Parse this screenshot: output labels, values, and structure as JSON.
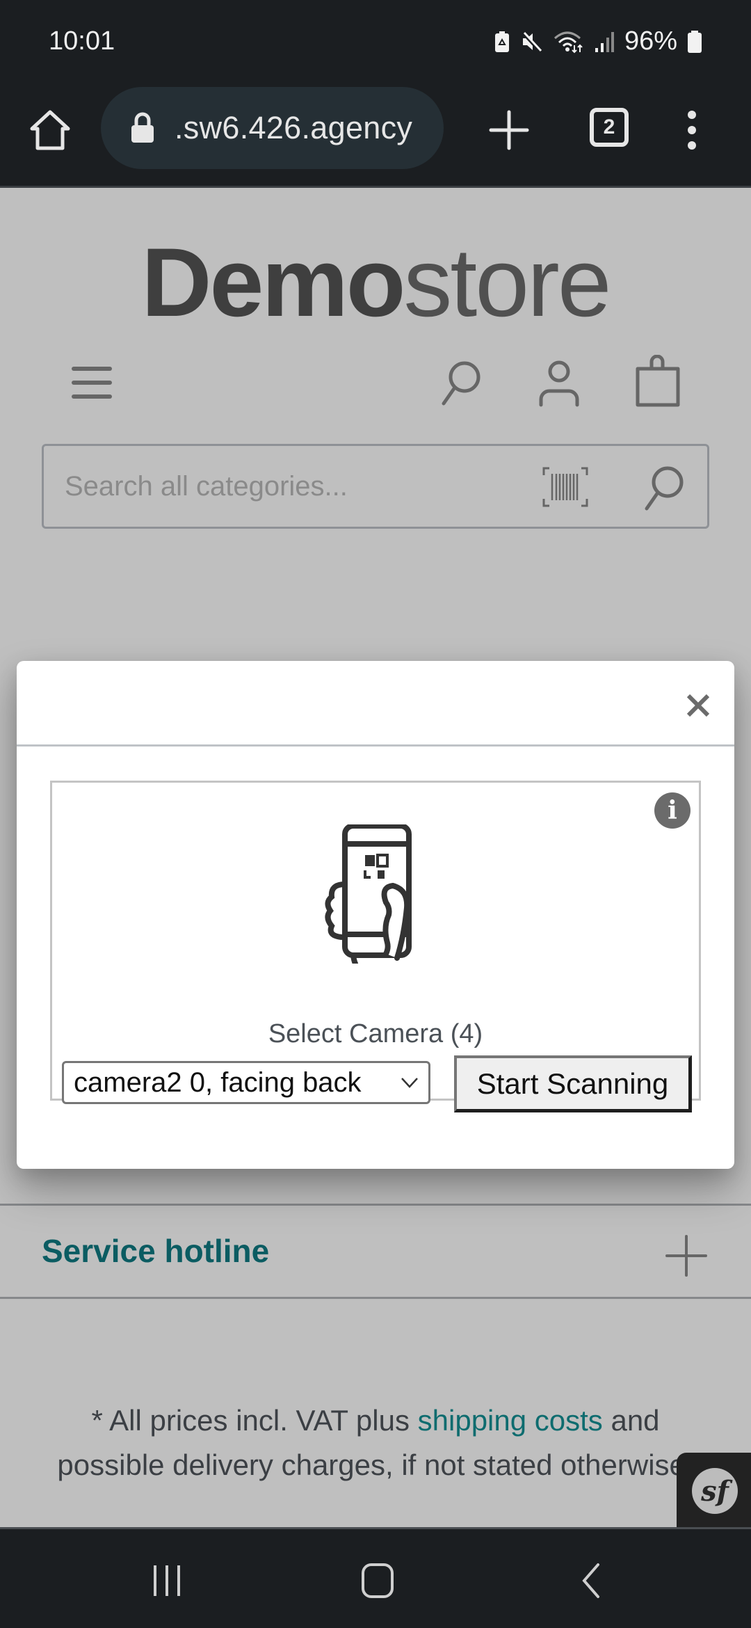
{
  "status_bar": {
    "time": "10:01",
    "battery_percent": "96%",
    "icons": [
      "battery-saver-icon",
      "mute-icon",
      "wifi-icon",
      "signal-icon",
      "battery-icon"
    ]
  },
  "browser": {
    "url": ".sw6.426.agency",
    "tab_count": "2",
    "icons": [
      "home-icon",
      "lock-icon",
      "new-tab-icon",
      "tabs-icon",
      "menu-icon"
    ]
  },
  "page": {
    "logo": {
      "bold": "Demo",
      "light": "store"
    },
    "header_icons": [
      "hamburger-menu-icon",
      "search-icon",
      "account-icon",
      "cart-icon"
    ],
    "search": {
      "placeholder": "Search all categories...",
      "value": ""
    },
    "accordion": {
      "title": "Service hotline"
    },
    "footnote": {
      "prefix": "* All prices incl. VAT plus ",
      "link": "shipping costs",
      "suffix": " and possible delivery charges, if not stated otherwise."
    },
    "debug_badge": "sf"
  },
  "modal": {
    "close_label": "×",
    "info_label": "i",
    "select_label": "Select Camera (4)",
    "camera_selected": "camera2 0, facing back",
    "start_button": "Start Scanning"
  },
  "colors": {
    "accent": "#0b5c62",
    "link": "#0e6c6f",
    "overlay_bg": "#bfbfbf",
    "system_bar": "#1b1e21"
  }
}
